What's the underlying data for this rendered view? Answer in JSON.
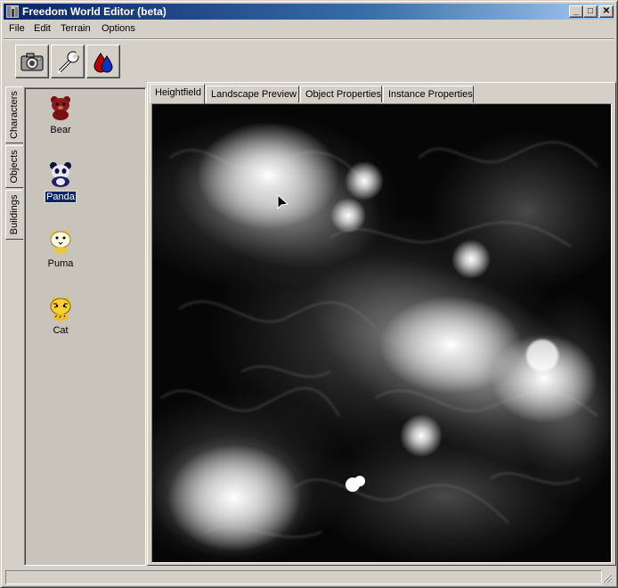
{
  "window": {
    "title": "Freedom World Editor (beta)",
    "controls": {
      "minimize": "_",
      "maximize": "□",
      "close": "✕"
    }
  },
  "menu": [
    "File",
    "Edit",
    "Terrain",
    "Options"
  ],
  "toolbar": [
    {
      "name": "camera-button",
      "icon": "camera-icon"
    },
    {
      "name": "wrench-button",
      "icon": "wrench-icon"
    },
    {
      "name": "drops-button",
      "icon": "drops-icon"
    }
  ],
  "side_tabs": [
    "Characters",
    "Objects",
    "Buildings"
  ],
  "characters": [
    {
      "label": "Bear",
      "icon": "bear-icon",
      "selected": false
    },
    {
      "label": "Panda",
      "icon": "panda-icon",
      "selected": true
    },
    {
      "label": "Puma",
      "icon": "puma-icon",
      "selected": false
    },
    {
      "label": "Cat",
      "icon": "cat-icon",
      "selected": false
    }
  ],
  "tabs": [
    "Heightfield",
    "Landscape Preview",
    "Object Properties",
    "Instance Properties"
  ],
  "active_tab": "Heightfield",
  "colors": {
    "title_start": "#0a246a",
    "title_end": "#a6caf0",
    "face": "#d4d0c8",
    "selection": "#0a246a"
  }
}
